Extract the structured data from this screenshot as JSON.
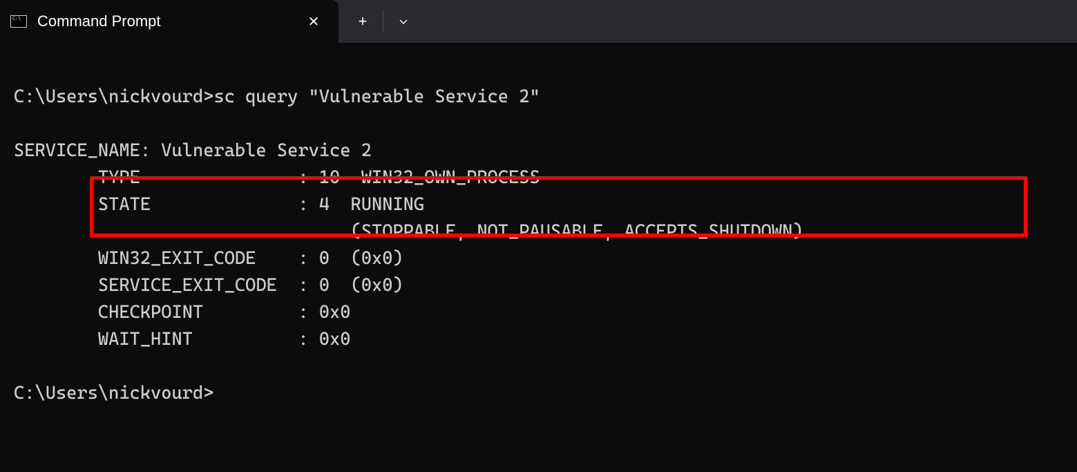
{
  "tab": {
    "title": "Command Prompt"
  },
  "terminal": {
    "prompt1": "C:\\Users\\nickvourd>",
    "command": "sc query \"Vulnerable Service 2\"",
    "blank1": "",
    "line_service_name": "SERVICE_NAME: Vulnerable Service 2",
    "line_type": "        TYPE               : 10  WIN32_OWN_PROCESS",
    "line_state": "        STATE              : 4  RUNNING",
    "line_state2": "                                (STOPPABLE, NOT_PAUSABLE, ACCEPTS_SHUTDOWN)",
    "line_win32exit": "        WIN32_EXIT_CODE    : 0  (0x0)",
    "line_svcexit": "        SERVICE_EXIT_CODE  : 0  (0x0)",
    "line_checkpoint": "        CHECKPOINT         : 0x0",
    "line_waithint": "        WAIT_HINT          : 0x0",
    "blank2": "",
    "prompt2": "C:\\Users\\nickvourd>"
  }
}
